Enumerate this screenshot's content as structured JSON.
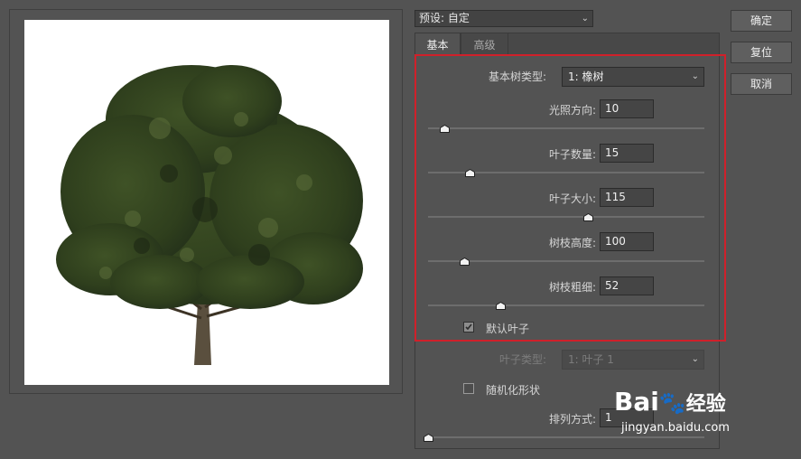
{
  "preset": {
    "label": "预设: 自定"
  },
  "buttons": {
    "ok": "确定",
    "reset": "复位",
    "cancel": "取消"
  },
  "tabs": {
    "basic": "基本",
    "advanced": "高级"
  },
  "base_tree": {
    "label": "基本树类型:",
    "value": "1: 橡树"
  },
  "sliders": [
    {
      "label": "光照方向:",
      "value": "10",
      "level": 0.06
    },
    {
      "label": "叶子数量:",
      "value": "15",
      "level": 0.15
    },
    {
      "label": "叶子大小:",
      "value": "115",
      "level": 0.58
    },
    {
      "label": "树枝高度:",
      "value": "100",
      "level": 0.13
    },
    {
      "label": "树枝粗细:",
      "value": "52",
      "level": 0.26
    }
  ],
  "default_leaves": {
    "label": "默认叶子",
    "checked": true
  },
  "leaf_type": {
    "label": "叶子类型:",
    "value": "1: 叶子 1"
  },
  "randomize": {
    "label": "随机化形状",
    "checked": false
  },
  "arrangement": {
    "label": "排列方式:",
    "value": "1",
    "level": 0.0
  },
  "watermark": {
    "brand_left": "Bai",
    "brand_right": "经验",
    "url": "jingyan.baidu.com"
  },
  "colors": {
    "highlight": "#d0202a",
    "foliage": "#34451f"
  }
}
